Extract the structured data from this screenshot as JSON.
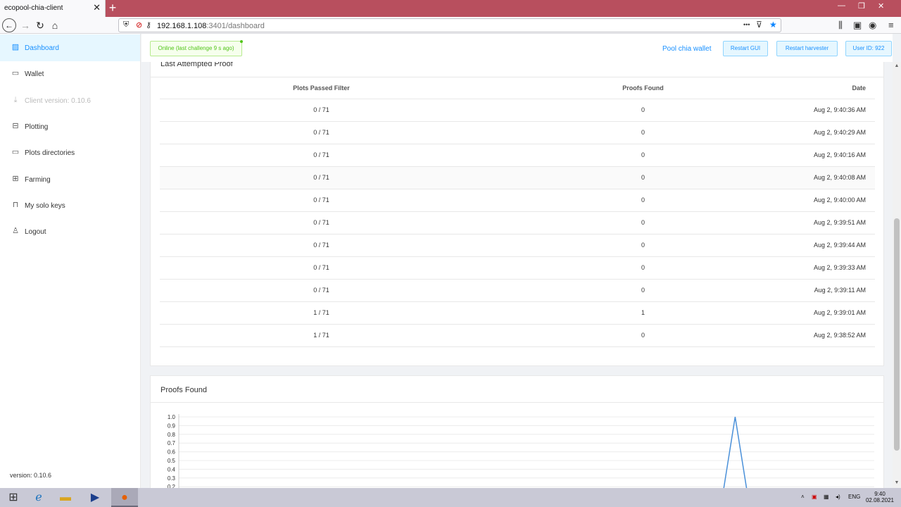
{
  "browser": {
    "tab_title": "ecopool-chia-client",
    "tab_close": "✕",
    "new_tab": "+",
    "url_host": "192.168.1.108",
    "url_path": ":3401/dashboard",
    "url_dots": "•••",
    "win_min": "—",
    "win_restore": "❐",
    "win_close": "✕"
  },
  "sidebar": {
    "items": [
      {
        "label": "Dashboard",
        "icon": "dashboard-icon"
      },
      {
        "label": "Wallet",
        "icon": "wallet-icon"
      },
      {
        "label": "Client version: 0.10.6",
        "icon": "download-icon"
      },
      {
        "label": "Plotting",
        "icon": "plotting-icon"
      },
      {
        "label": "Plots directories",
        "icon": "folder-icon"
      },
      {
        "label": "Farming",
        "icon": "farming-icon"
      },
      {
        "label": "My solo keys",
        "icon": "lock-icon"
      },
      {
        "label": "Logout",
        "icon": "user-icon"
      }
    ],
    "version": "version: 0.10.6"
  },
  "header": {
    "status": "Online (last challenge 9 s ago)",
    "pool_link": "Pool chia wallet",
    "restart_gui": "Restart GUI",
    "restart_harvester": "Restart harvester",
    "user_id": "User ID: 922"
  },
  "proof_table": {
    "title": "Last Attempted Proof",
    "columns": [
      "Plots Passed Filter",
      "Proofs Found",
      "Date"
    ],
    "rows": [
      [
        "0 / 71",
        "0",
        "Aug 2, 9:40:36 AM"
      ],
      [
        "0 / 71",
        "0",
        "Aug 2, 9:40:29 AM"
      ],
      [
        "0 / 71",
        "0",
        "Aug 2, 9:40:16 AM"
      ],
      [
        "0 / 71",
        "0",
        "Aug 2, 9:40:08 AM"
      ],
      [
        "0 / 71",
        "0",
        "Aug 2, 9:40:00 AM"
      ],
      [
        "0 / 71",
        "0",
        "Aug 2, 9:39:51 AM"
      ],
      [
        "0 / 71",
        "0",
        "Aug 2, 9:39:44 AM"
      ],
      [
        "0 / 71",
        "0",
        "Aug 2, 9:39:33 AM"
      ],
      [
        "0 / 71",
        "0",
        "Aug 2, 9:39:11 AM"
      ],
      [
        "1 / 71",
        "1",
        "Aug 2, 9:39:01 AM"
      ],
      [
        "1 / 71",
        "0",
        "Aug 2, 9:38:52 AM"
      ]
    ],
    "highlighted_row": 3
  },
  "proofs_chart": {
    "title": "Proofs Found",
    "yticks": [
      "1.0",
      "0.9",
      "0.8",
      "0.7",
      "0.6",
      "0.5",
      "0.4",
      "0.3",
      "0.2"
    ]
  },
  "chart_data": {
    "type": "line",
    "title": "Proofs Found",
    "xlabel": "",
    "ylabel": "",
    "ylim_visible": [
      0.2,
      1.0
    ],
    "series": [
      {
        "values": [
          0,
          0,
          0,
          0,
          0,
          0,
          0,
          0,
          0,
          0,
          0,
          0,
          0,
          0,
          0,
          0,
          0,
          0,
          0,
          0,
          0,
          0,
          0,
          0,
          0,
          0,
          0,
          0,
          0,
          0,
          0,
          0,
          0,
          0,
          0,
          0,
          0,
          0,
          0,
          0,
          1,
          0,
          0,
          0,
          0,
          0,
          0,
          0,
          0,
          0,
          0
        ],
        "color": "#4a90d9"
      }
    ],
    "grid": true
  },
  "taskbar": {
    "lang": "ENG",
    "time": "9:40",
    "date": "02.08.2021"
  }
}
